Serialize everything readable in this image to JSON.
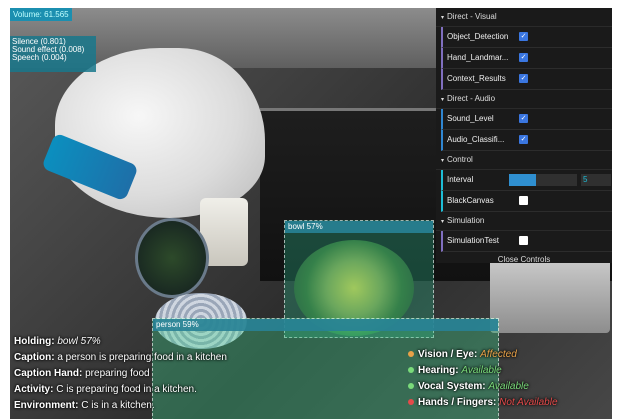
{
  "audio": {
    "volume": "Volume: 61.565",
    "classes": [
      "Silence (0.801)",
      "Sound effect (0.008)",
      "Speech (0.004)"
    ]
  },
  "detections": [
    {
      "label": "bowl 57%"
    },
    {
      "label": "person 59%"
    }
  ],
  "controls": {
    "direct_visual": "Direct - Visual",
    "object_detection": "Object_Detection",
    "hand_landmark": "Hand_Landmar...",
    "context_results": "Context_Results",
    "direct_audio": "Direct - Audio",
    "sound_level": "Sound_Level",
    "audio_classifi": "Audio_Classifi...",
    "control": "Control",
    "interval": "Interval",
    "interval_value": "5",
    "interval_fraction": 0.4,
    "black_canvas": "BlackCanvas",
    "simulation": "Simulation",
    "simulation_test": "SimulationTest",
    "close": "Close Controls"
  },
  "status_left": {
    "holding_label": "Holding:",
    "holding_value": "bowl 57%",
    "caption_label": "Caption:",
    "caption_value": "a person is preparing food in a kitchen",
    "caption_hand_label": "Caption Hand:",
    "caption_hand_value": "preparing food",
    "activity_label": "Activity:",
    "activity_value": "C is preparing food in a kitchen.",
    "environment_label": "Environment:",
    "environment_value": "C is in a kitchen."
  },
  "status_right": [
    {
      "label": "Vision / Eye:",
      "value": "Affected",
      "color": "#e8a148"
    },
    {
      "label": "Hearing:",
      "value": "Available",
      "color": "#7adb7a"
    },
    {
      "label": "Vocal System:",
      "value": "Available",
      "color": "#7adb7a"
    },
    {
      "label": "Hands / Fingers:",
      "value": "Not Available",
      "color": "#e54a4a"
    }
  ]
}
